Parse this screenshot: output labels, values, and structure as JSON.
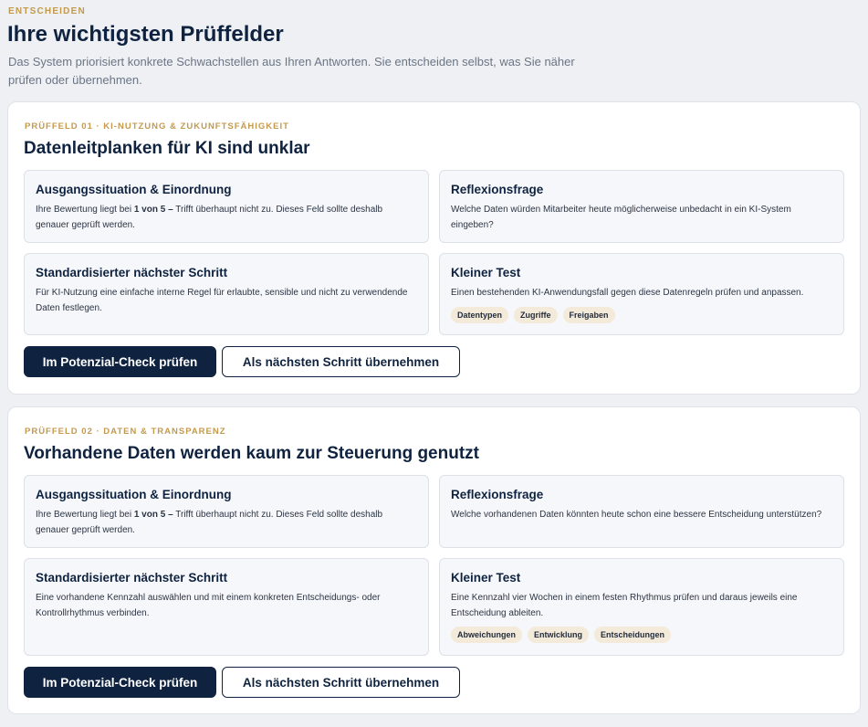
{
  "header": {
    "eyebrow": "ENTSCHEIDEN",
    "title": "Ihre wichtigsten Prüffelder",
    "description": "Das System priorisiert konkrete Schwachstellen aus Ihren Antworten. Sie entscheiden selbst, was Sie näher prüfen oder übernehmen."
  },
  "colors": {
    "navy": "#0f2340",
    "gold": "#c39a4d",
    "tag_bg": "#f3ead9",
    "box_bg": "#f6f7fa"
  },
  "fields": [
    {
      "eyebrow": "PRÜFFELD 01 · KI-NUTZUNG & ZUKUNFTSFÄHIGKEIT",
      "title": "Datenleitplanken für KI sind unklar",
      "situation": {
        "title": "Ausgangssituation & Einordnung",
        "text_pre": "Ihre Bewertung liegt bei ",
        "text_bold": "1 von 5 –",
        "text_post": " Trifft überhaupt nicht zu. Dieses Feld sollte deshalb genauer geprüft werden."
      },
      "reflection": {
        "title": "Reflexionsfrage",
        "text": "Welche Daten würden Mitarbeiter heute möglicherweise unbedacht in ein KI-System eingeben?"
      },
      "next_step": {
        "title": "Standardisierter nächster Schritt",
        "text": "Für KI-Nutzung eine einfache interne Regel für erlaubte, sensible und nicht zu verwendende Daten festlegen."
      },
      "test": {
        "title": "Kleiner Test",
        "text": "Einen bestehenden KI-Anwendungsfall gegen diese Datenregeln prüfen und anpassen.",
        "tags": [
          "Datentypen",
          "Zugriffe",
          "Freigaben"
        ]
      },
      "primary_label": "Im Potenzial-Check prüfen",
      "secondary_label": "Als nächsten Schritt übernehmen"
    },
    {
      "eyebrow": "PRÜFFELD 02 · DATEN & TRANSPARENZ",
      "title": "Vorhandene Daten werden kaum zur Steuerung genutzt",
      "situation": {
        "title": "Ausgangssituation & Einordnung",
        "text_pre": "Ihre Bewertung liegt bei ",
        "text_bold": "1 von 5 –",
        "text_post": " Trifft überhaupt nicht zu. Dieses Feld sollte deshalb genauer geprüft werden."
      },
      "reflection": {
        "title": "Reflexionsfrage",
        "text": "Welche vorhandenen Daten könnten heute schon eine bessere Entscheidung unterstützen?"
      },
      "next_step": {
        "title": "Standardisierter nächster Schritt",
        "text": "Eine vorhandene Kennzahl auswählen und mit einem konkreten Entscheidungs- oder Kontrollrhythmus verbinden."
      },
      "test": {
        "title": "Kleiner Test",
        "text": "Eine Kennzahl vier Wochen in einem festen Rhythmus prüfen und daraus jeweils eine Entscheidung ableiten.",
        "tags": [
          "Abweichungen",
          "Entwicklung",
          "Entscheidungen"
        ]
      },
      "primary_label": "Im Potenzial-Check prüfen",
      "secondary_label": "Als nächsten Schritt übernehmen"
    }
  ]
}
